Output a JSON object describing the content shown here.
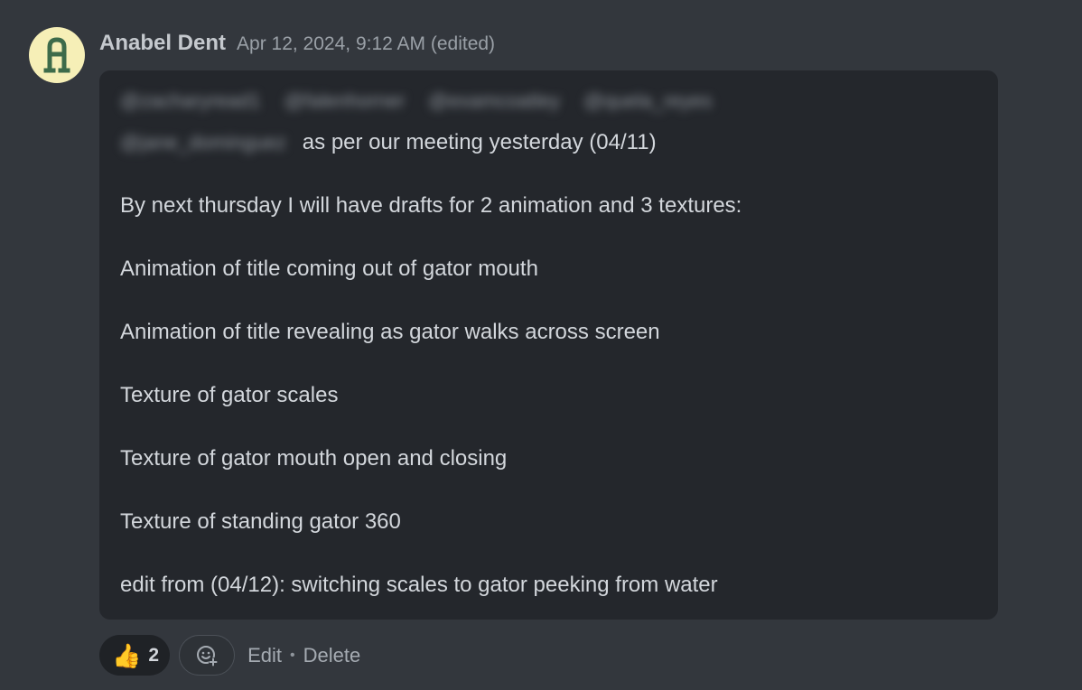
{
  "author": {
    "name": "Anabel Dent",
    "avatar_initial": "A",
    "avatar_color": "#f6efb7"
  },
  "timestamp": "Apr 12, 2024, 9:12 AM",
  "edited_label": "(edited)",
  "mentions": [
    "@zacharyread1",
    "@falenhorner",
    "@examcoatley",
    "@quela_reyes",
    "@jane_dominguez"
  ],
  "intro_text": "as per our meeting yesterday (04/11)",
  "lines": [
    "By next thursday I will have drafts for 2 animation and 3 textures:",
    "Animation of title coming out of gator mouth",
    "Animation of title revealing as gator walks across screen",
    "Texture of gator scales",
    "Texture of gator mouth open and closing",
    "Texture of standing gator 360",
    "edit from (04/12): switching scales to gator peeking from water"
  ],
  "reaction": {
    "emoji": "👍",
    "count": "2"
  },
  "actions": {
    "edit": "Edit",
    "separator": "•",
    "delete": "Delete"
  },
  "icons": {
    "add_reaction": "add-reaction-icon"
  }
}
